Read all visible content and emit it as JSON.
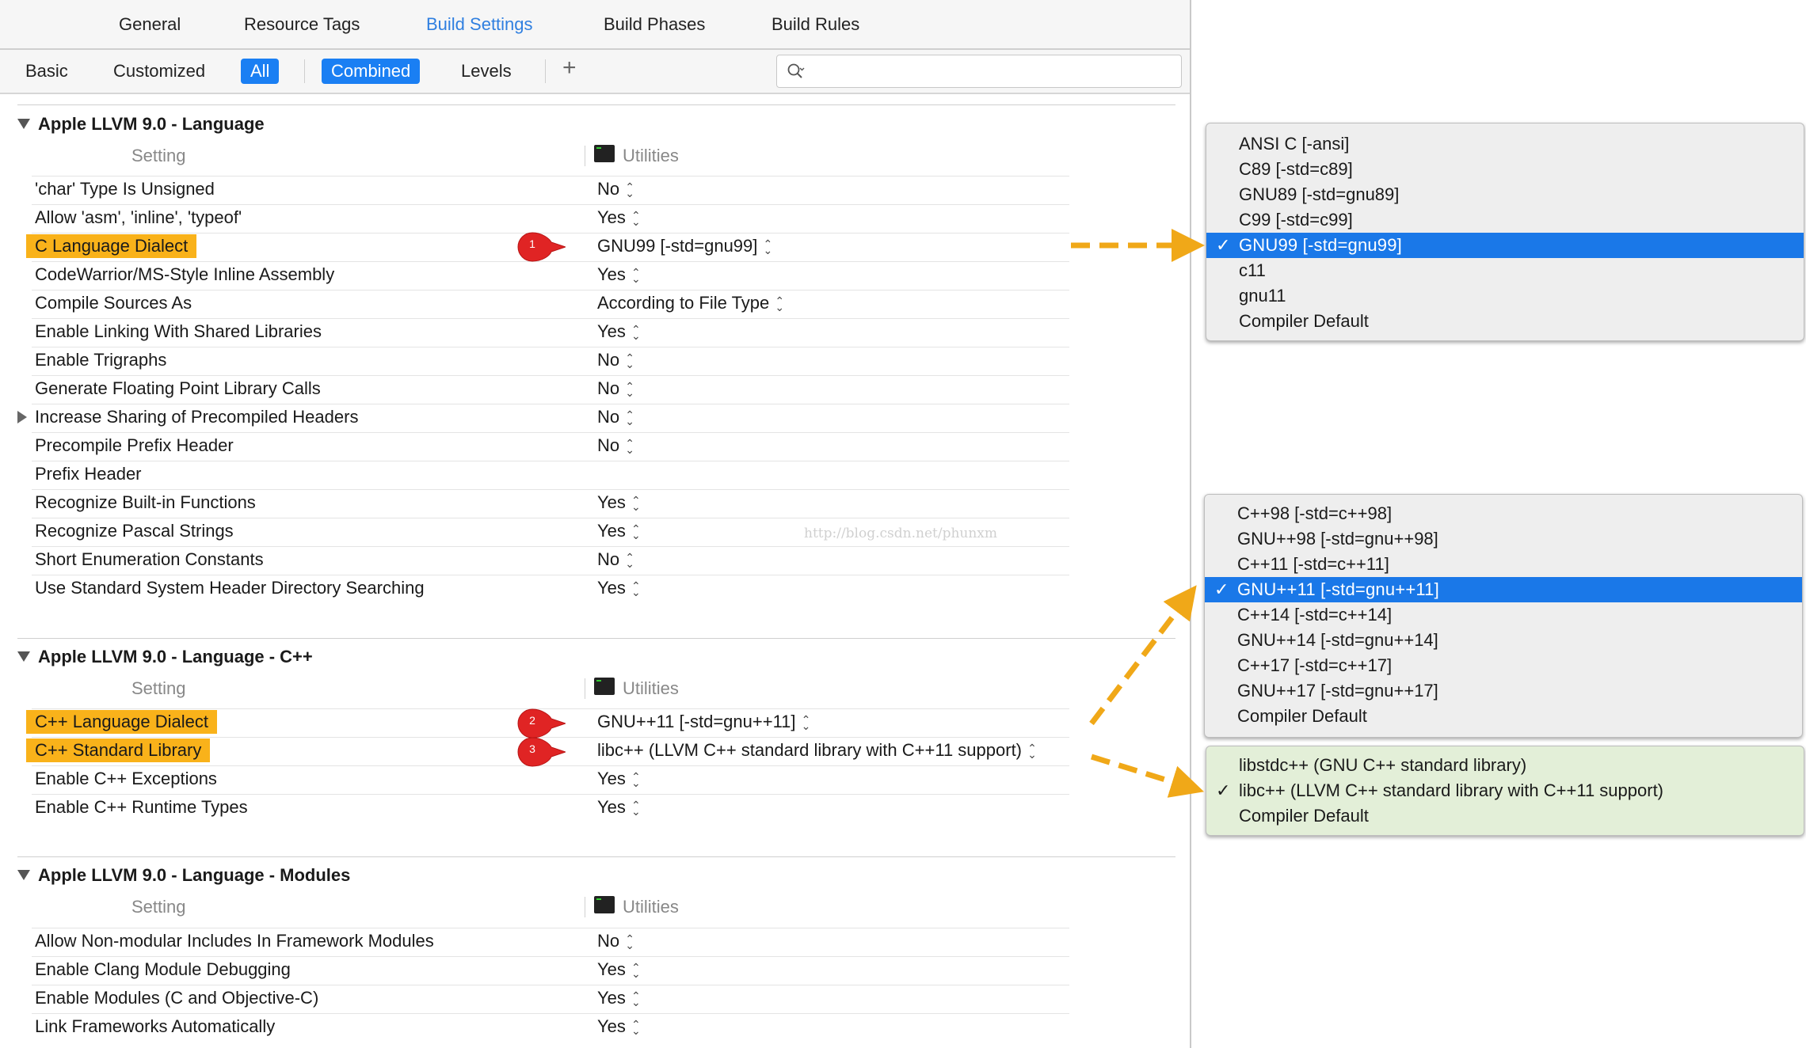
{
  "tabs": [
    "General",
    "Resource Tags",
    "Build Settings",
    "Build Phases",
    "Build Rules"
  ],
  "active_tab": "Build Settings",
  "filter": {
    "basic": "Basic",
    "customized": "Customized",
    "all": "All",
    "combined": "Combined",
    "levels": "Levels",
    "plus": "+",
    "search_value": ""
  },
  "columns": {
    "setting": "Setting",
    "target": "Utilities"
  },
  "sections": [
    {
      "title": "Apple LLVM 9.0 - Language",
      "rows": [
        {
          "name": "'char' Type Is Unsigned",
          "value": "No"
        },
        {
          "name": "Allow 'asm', 'inline', 'typeof'",
          "value": "Yes"
        },
        {
          "name": "C Language Dialect",
          "value": "GNU99 [-std=gnu99]"
        },
        {
          "name": "CodeWarrior/MS-Style Inline Assembly",
          "value": "Yes"
        },
        {
          "name": "Compile Sources As",
          "value": "According to File Type"
        },
        {
          "name": "Enable Linking With Shared Libraries",
          "value": "Yes"
        },
        {
          "name": "Enable Trigraphs",
          "value": "No"
        },
        {
          "name": "Generate Floating Point Library Calls",
          "value": "No"
        },
        {
          "name": "Increase Sharing of Precompiled Headers",
          "value": "No"
        },
        {
          "name": "Precompile Prefix Header",
          "value": "No"
        },
        {
          "name": "Prefix Header",
          "value": ""
        },
        {
          "name": "Recognize Built-in Functions",
          "value": "Yes"
        },
        {
          "name": "Recognize Pascal Strings",
          "value": "Yes"
        },
        {
          "name": "Short Enumeration Constants",
          "value": "No"
        },
        {
          "name": "Use Standard System Header Directory Searching",
          "value": "Yes"
        }
      ]
    },
    {
      "title": "Apple LLVM 9.0 - Language - C++",
      "rows": [
        {
          "name": "C++ Language Dialect",
          "value": "GNU++11 [-std=gnu++11]"
        },
        {
          "name": "C++ Standard Library",
          "value": "libc++ (LLVM C++ standard library with C++11 support)"
        },
        {
          "name": "Enable C++ Exceptions",
          "value": "Yes"
        },
        {
          "name": "Enable C++ Runtime Types",
          "value": "Yes"
        }
      ]
    },
    {
      "title": "Apple LLVM 9.0 - Language - Modules",
      "rows": [
        {
          "name": "Allow Non-modular Includes In Framework Modules",
          "value": "No"
        },
        {
          "name": "Enable Clang Module Debugging",
          "value": "Yes"
        },
        {
          "name": "Enable Modules (C and Objective-C)",
          "value": "Yes"
        },
        {
          "name": "Link Frameworks Automatically",
          "value": "Yes"
        }
      ]
    }
  ],
  "badges": [
    "1",
    "2",
    "3"
  ],
  "watermark": "http://blog.csdn.net/phunxm",
  "popups": {
    "c_dialect": {
      "options": [
        "ANSI C [-ansi]",
        "C89 [-std=c89]",
        "GNU89 [-std=gnu89]",
        "C99 [-std=c99]",
        "GNU99 [-std=gnu99]",
        "c11",
        "gnu11",
        "Compiler Default"
      ],
      "selected": "GNU99 [-std=gnu99]"
    },
    "cpp_dialect": {
      "options": [
        "C++98 [-std=c++98]",
        "GNU++98 [-std=gnu++98]",
        "C++11 [-std=c++11]",
        "GNU++11 [-std=gnu++11]",
        "C++14 [-std=c++14]",
        "GNU++14 [-std=gnu++14]",
        "C++17 [-std=c++17]",
        "GNU++17 [-std=gnu++17]",
        "Compiler Default"
      ],
      "selected": "GNU++11 [-std=gnu++11]"
    },
    "cpp_stdlib": {
      "options": [
        "libstdc++ (GNU C++ standard library)",
        "libc++ (LLVM C++ standard library with C++11 support)",
        "Compiler Default"
      ],
      "selected": "libc++ (LLVM C++ standard library with C++11 support)"
    }
  },
  "colors": {
    "accent": "#1a7ff3",
    "highlight": "#f9b21a",
    "badge": "#e02424",
    "arrow": "#f0a818",
    "popup_green": "#e3efd8"
  }
}
